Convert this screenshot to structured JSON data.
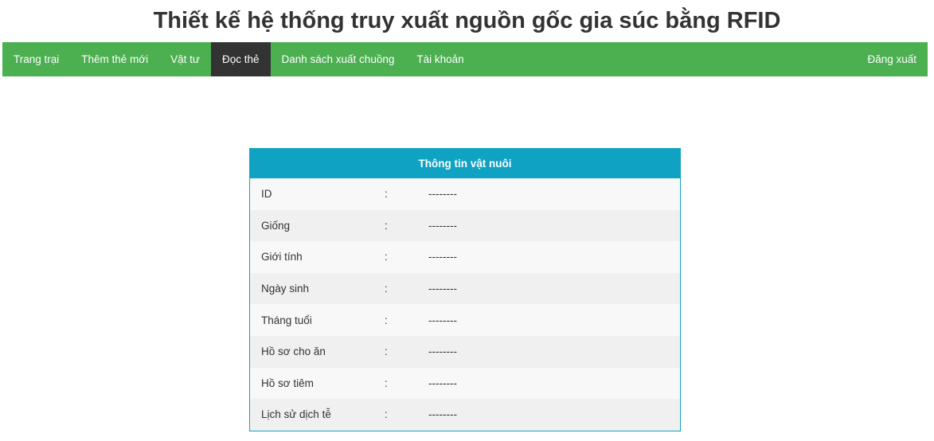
{
  "header": {
    "title": "Thiết kế hệ thống truy xuất nguồn gốc gia súc bằng RFID"
  },
  "nav": {
    "items": [
      {
        "label": "Trang trại",
        "active": false
      },
      {
        "label": "Thêm thẻ mới",
        "active": false
      },
      {
        "label": "Vật tư",
        "active": false
      },
      {
        "label": "Đọc thẻ",
        "active": true
      },
      {
        "label": "Danh sách xuất chuồng",
        "active": false
      },
      {
        "label": "Tài khoản",
        "active": false
      }
    ],
    "logout_label": "Đăng xuất",
    "bg_color": "#4caf50",
    "active_color": "#333333"
  },
  "card": {
    "title": "Thông tin vật nuôi",
    "accent_color": "#10a2c3",
    "rows": [
      {
        "label": "ID",
        "sep": ":",
        "value": "--------"
      },
      {
        "label": "Giống",
        "sep": ":",
        "value": "--------"
      },
      {
        "label": "Giới tính",
        "sep": ":",
        "value": "--------"
      },
      {
        "label": "Ngày sinh",
        "sep": ":",
        "value": "--------"
      },
      {
        "label": "Tháng tuổi",
        "sep": ":",
        "value": "--------"
      },
      {
        "label": "Hồ sơ cho ăn",
        "sep": ":",
        "value": "--------"
      },
      {
        "label": "Hồ sơ tiêm",
        "sep": ":",
        "value": "--------"
      },
      {
        "label": "Lịch sử dịch tễ",
        "sep": ":",
        "value": "--------"
      }
    ]
  }
}
